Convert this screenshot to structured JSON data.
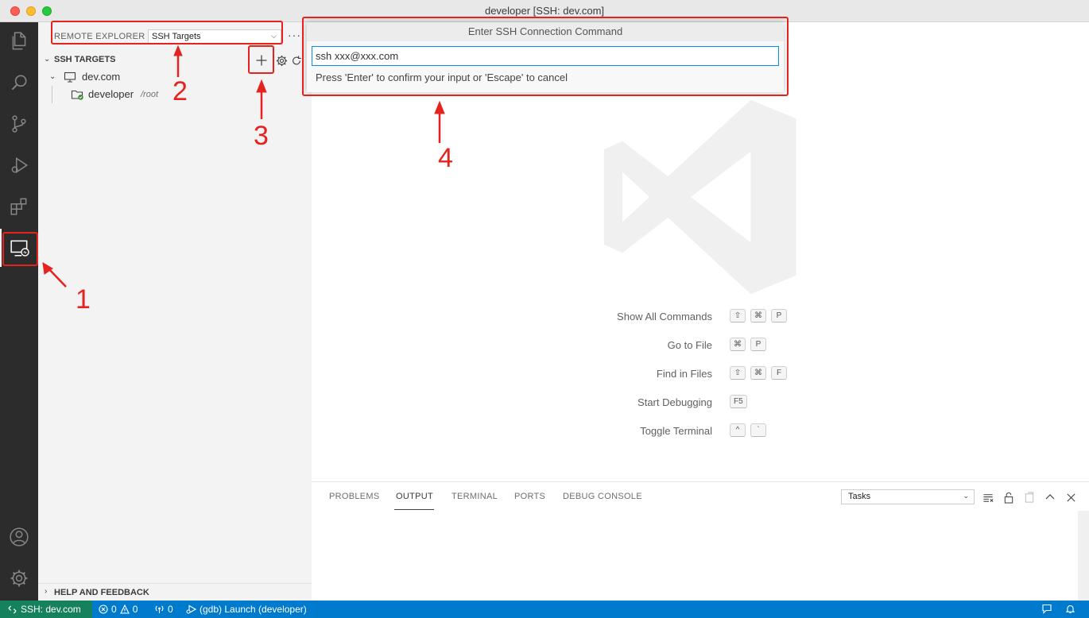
{
  "window": {
    "title": "developer [SSH: dev.com]"
  },
  "sidebar": {
    "header_title": "REMOTE EXPLORER",
    "target_select": "SSH Targets",
    "more": "···",
    "section_title": "SSH TARGETS",
    "host": {
      "label": "dev.com"
    },
    "folder": {
      "label": "developer",
      "path": "/root"
    }
  },
  "quick_input": {
    "title": "Enter SSH Connection Command",
    "value": "ssh xxx@xxx.com",
    "message": "Press 'Enter' to confirm your input or 'Escape' to cancel"
  },
  "welcome": {
    "shortcuts": [
      {
        "label": "Show All Commands",
        "keys": [
          "⇧",
          "⌘",
          "P"
        ]
      },
      {
        "label": "Go to File",
        "keys": [
          "⌘",
          "P"
        ]
      },
      {
        "label": "Find in Files",
        "keys": [
          "⇧",
          "⌘",
          "F"
        ]
      },
      {
        "label": "Start Debugging",
        "keys": [
          "F5"
        ]
      },
      {
        "label": "Toggle Terminal",
        "keys": [
          "^",
          "`"
        ]
      }
    ]
  },
  "panel": {
    "tabs": [
      "PROBLEMS",
      "OUTPUT",
      "TERMINAL",
      "PORTS",
      "DEBUG CONSOLE"
    ],
    "active_tab": "OUTPUT",
    "output_select": "Tasks"
  },
  "help": {
    "title": "HELP AND FEEDBACK"
  },
  "statusbar": {
    "remote": "SSH: dev.com",
    "errors": "0",
    "warnings": "0",
    "ports": "0",
    "debug": "(gdb) Launch (developer)"
  },
  "annotations": [
    "1",
    "2",
    "3",
    "4"
  ],
  "colors": {
    "accent": "#007acc",
    "remote": "#16825d",
    "annotation": "#e5221d",
    "activity_bar": "#2c2c2c"
  }
}
